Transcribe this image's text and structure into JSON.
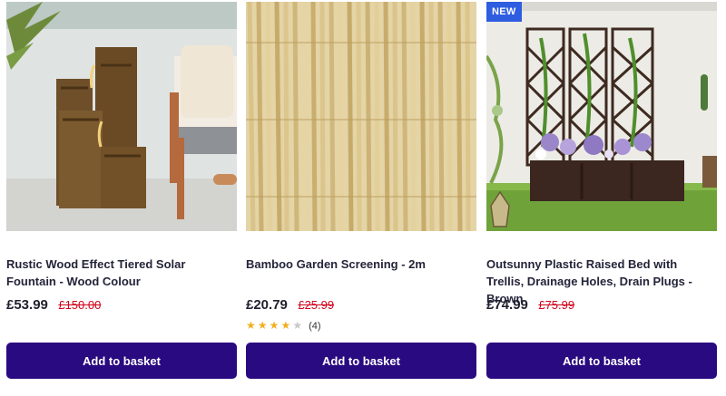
{
  "products": [
    {
      "title": "Rustic Wood Effect Tiered Solar Fountain - Wood Colour",
      "price": "£53.99",
      "was_price": "£150.00",
      "image_alt": "Rustic wood effect tiered solar fountain on a patio",
      "button_label": "Add to basket"
    },
    {
      "title": "Bamboo Garden Screening - 2m",
      "price": "£20.79",
      "was_price": "£25.99",
      "rating": {
        "stars": 4,
        "out_of": 5,
        "count": "(4)"
      },
      "image_alt": "Close-up of bamboo garden screening",
      "button_label": "Add to basket"
    },
    {
      "badge": "NEW",
      "title": "Outsunny Plastic Raised Bed with Trellis, Drainage Holes, Drain Plugs - Brown",
      "price": "£74.99",
      "was_price": "£75.99",
      "image_alt": "Brown raised bed with trellis and flowers",
      "button_label": "Add to basket"
    }
  ],
  "colors": {
    "button_bg": "#2a0a80",
    "was_price": "#d0021b",
    "badge_bg": "#2f5de0",
    "star": "#f2b01e"
  }
}
